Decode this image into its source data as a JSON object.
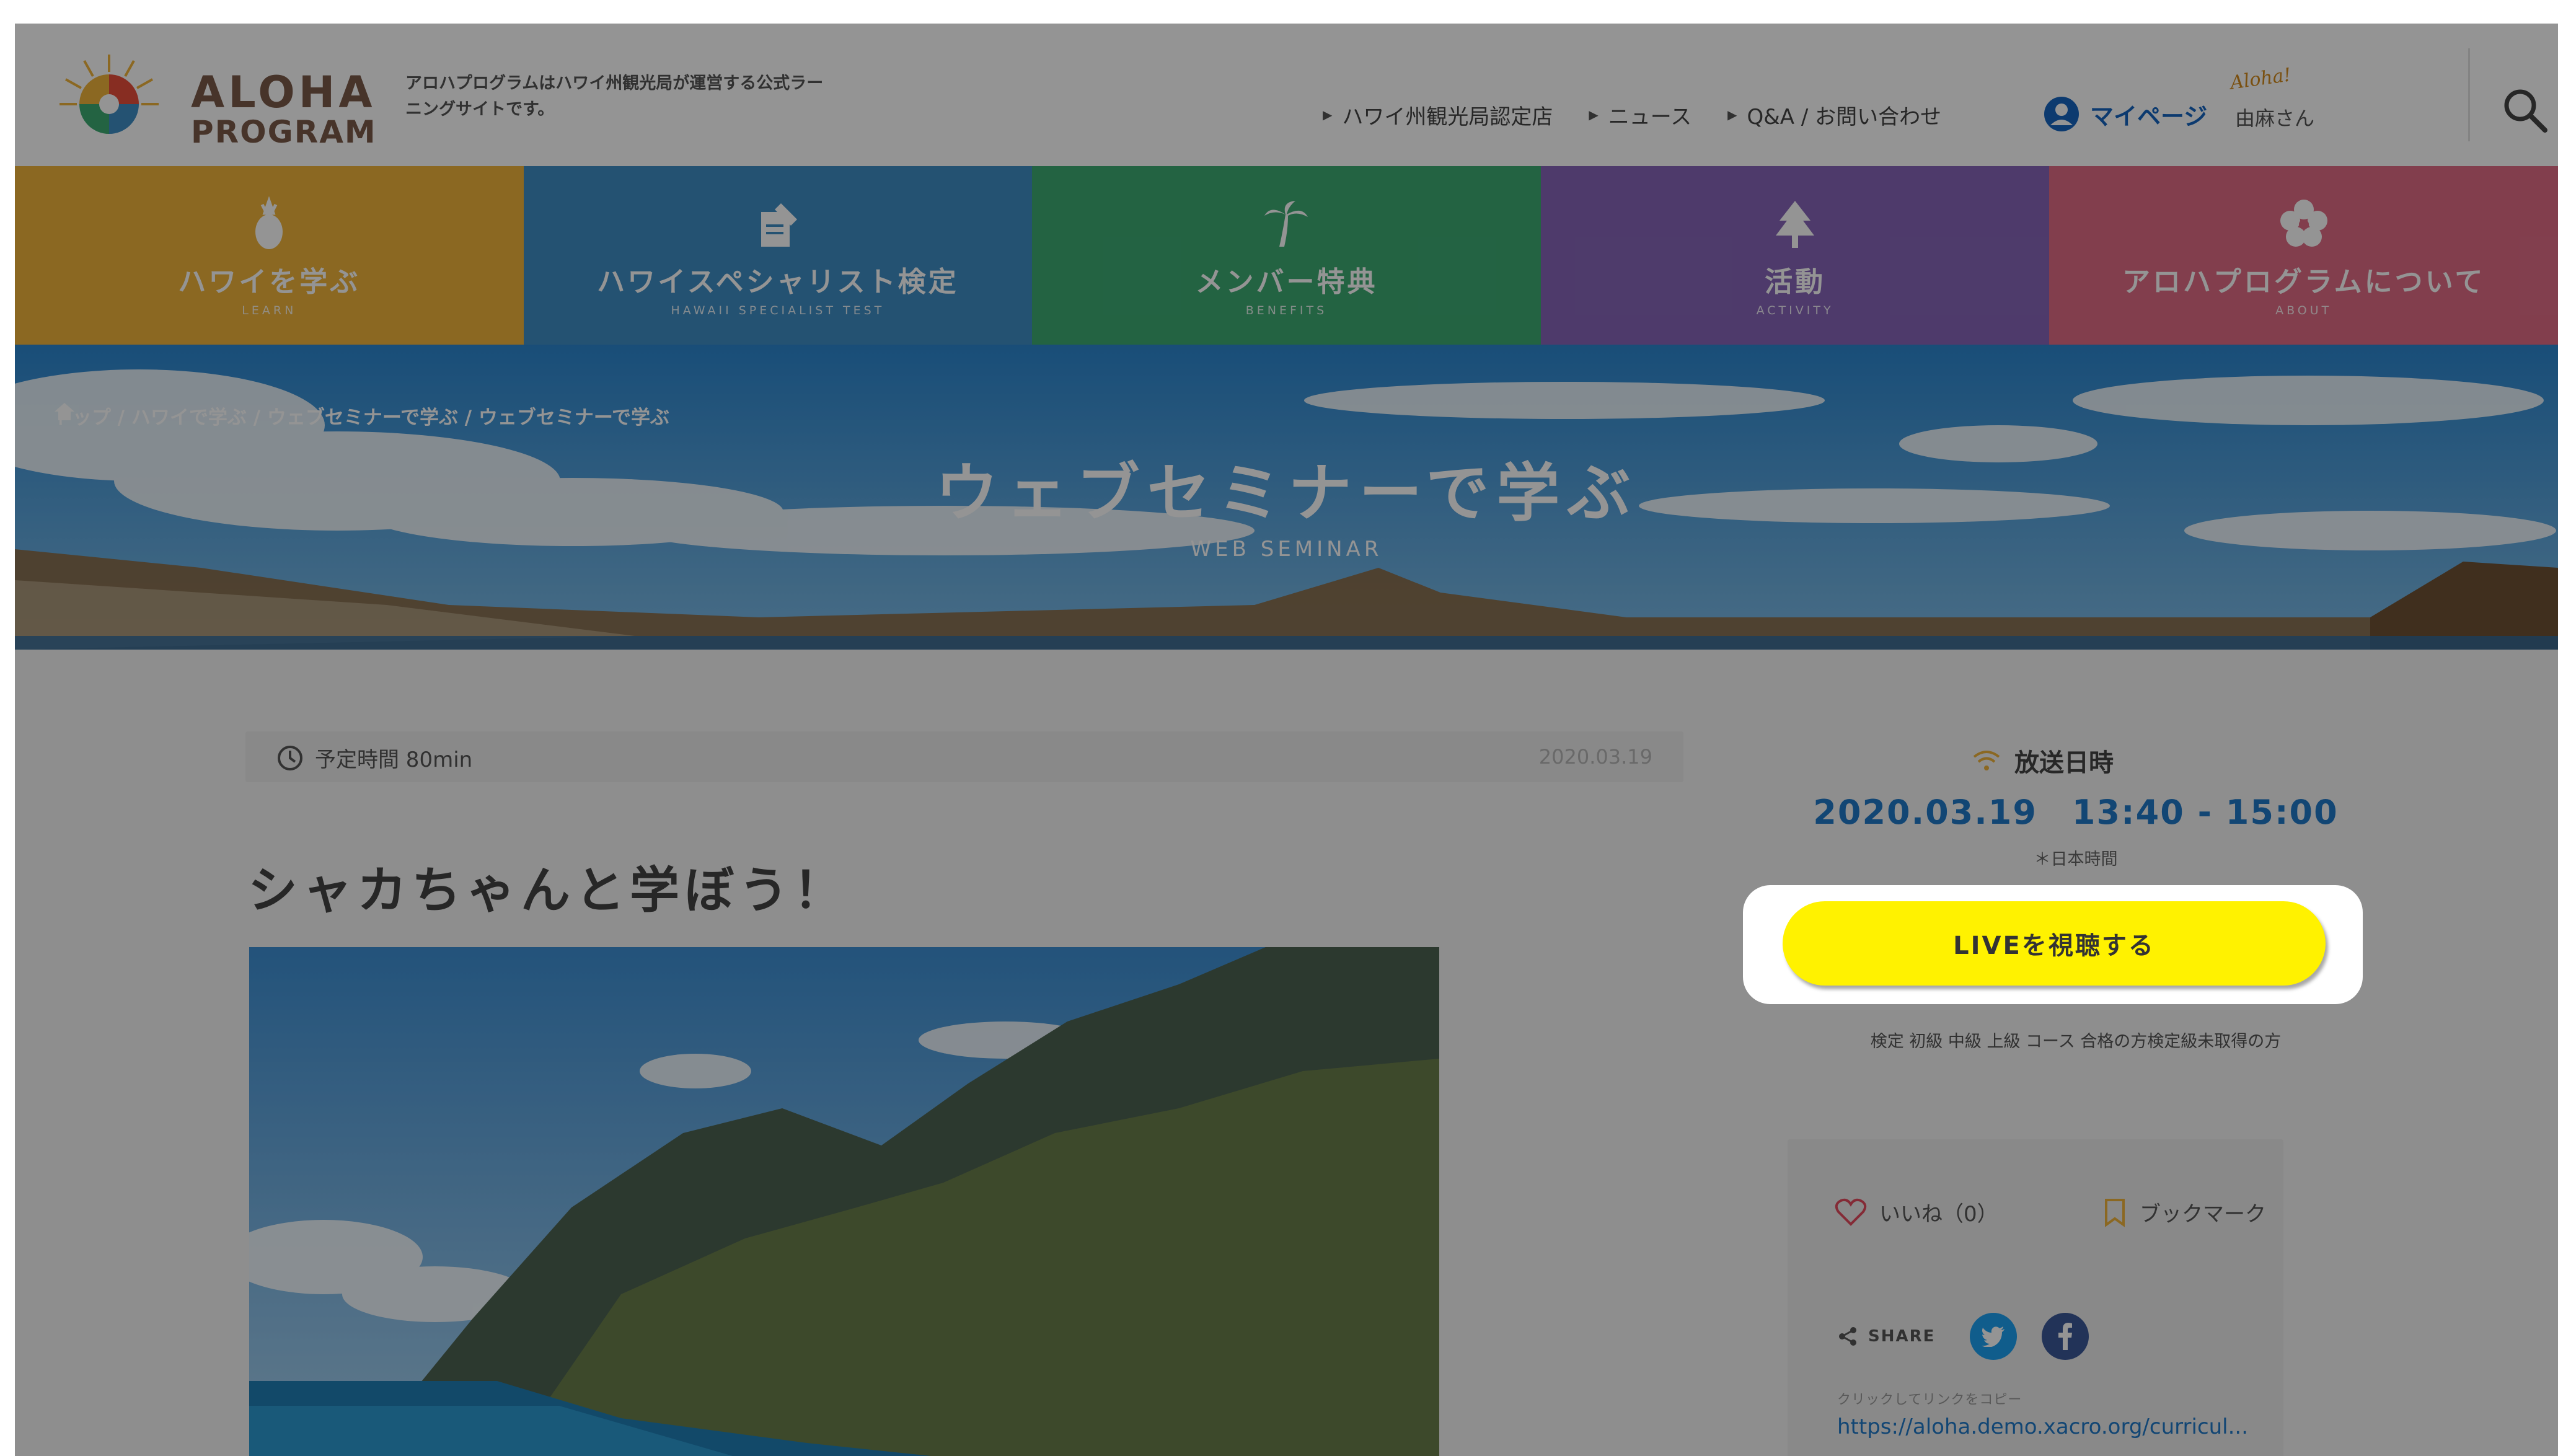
{
  "header": {
    "logo_line1": "ALOHA",
    "logo_line2": "PROGRAM",
    "tagline": "アロハプログラムはハワイ州観光局が運営する公式ラーニングサイトです。",
    "topnav": [
      {
        "label": "ハワイ州観光局認定店"
      },
      {
        "label": "ニュース"
      },
      {
        "label": "Q&A / お問い合わせ"
      }
    ],
    "mypage_label": "マイページ",
    "user_name": "由麻さん",
    "greeting": "Aloha!",
    "search_icon": "search-icon"
  },
  "categories": [
    {
      "label": "ハワイを学ぶ",
      "sub": "LEARN",
      "color": "#f0b33b",
      "icon": "pineapple-icon"
    },
    {
      "label": "ハワイスペシャリスト検定",
      "sub": "HAWAII SPECIALIST TEST",
      "color": "#3f8ec4",
      "icon": "pencil-paper-icon"
    },
    {
      "label": "メンバー特典",
      "sub": "BENEFITS",
      "color": "#3dab73",
      "icon": "palm-tree-icon"
    },
    {
      "label": "活動",
      "sub": "ACTIVITY",
      "color": "#8765b8",
      "icon": "tree-icon"
    },
    {
      "label": "アロハプログラムについて",
      "sub": "ABOUT",
      "color": "#e06c86",
      "icon": "flower-icon"
    }
  ],
  "hero": {
    "breadcrumb": "トップ / ハワイで学ぶ / ウェブセミナーで学ぶ / ウェブセミナーで学ぶ",
    "title": "ウェブセミナーで学ぶ",
    "subtitle": "WEB SEMINAR"
  },
  "article": {
    "duration": "予定時間 80min",
    "date": "2020.03.19",
    "title": "シャカちゃんと学ぼう！"
  },
  "sidebar": {
    "broadcast_label": "放送日時",
    "broadcast_datetime": "2020.03.19　13:40 - 15:00",
    "broadcast_note": "＊日本時間",
    "live_button": "LIVEを視聴する",
    "eligibility": "検定 初級 中級 上級 コース 合格の方検定級未取得の方",
    "like_label": "いいね（0）",
    "bookmark_label": "ブックマーク",
    "share_label": "SHARE",
    "copy_hint": "クリックしてリンクをコピー",
    "copy_url": "https://aloha.demo.xacro.org/curricul..."
  },
  "colors": {
    "accent_blue": "#1f79c9",
    "live_yellow": "#fff200",
    "twitter": "#1da1f2",
    "facebook": "#3b5998"
  }
}
